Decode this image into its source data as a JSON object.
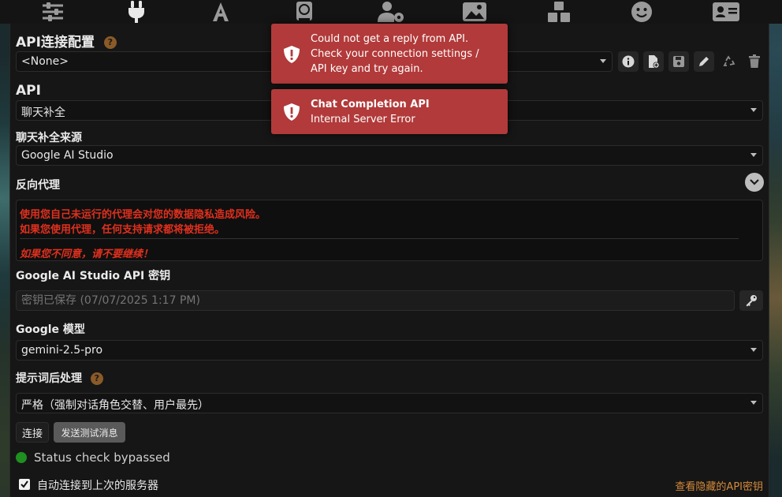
{
  "colors": {
    "panel_bg": "#161616",
    "toast_bg": "#b23a3a",
    "warning_text": "#e0301e",
    "help_badge": "#8a5a28",
    "status_dot": "#1f8f1f",
    "link": "#d58a3a"
  },
  "nav_icons": [
    "sliders-icon",
    "plug-icon",
    "font-icon",
    "book-globe-icon",
    "user-gear-icon",
    "image-icon",
    "cubes-icon",
    "smile-icon",
    "id-card-icon"
  ],
  "connection_profile": {
    "heading": "API连接配置",
    "help": "?",
    "selected": "<None>"
  },
  "api": {
    "heading": "API",
    "selected": "聊天补全"
  },
  "chat_source": {
    "heading": "聊天补全来源",
    "selected": "Google AI Studio"
  },
  "reverse_proxy": {
    "heading": "反向代理",
    "warning_line1": "使用您自己未运行的代理会对您的数据隐私造成风险。",
    "warning_line2": "如果您使用代理，任何支持请求都将被拒绝。",
    "warning_line3": "如果您不同意，请不要继续！"
  },
  "api_key": {
    "heading": "Google AI Studio API 密钥",
    "placeholder": "密钥已保存 (07/07/2025 1:17 PM)"
  },
  "model": {
    "heading": "Google 模型",
    "selected": "gemini-2.5-pro"
  },
  "prompt_processing": {
    "heading": "提示词后处理",
    "help": "?",
    "selected": "严格（强制对话角色交替、用户最先）"
  },
  "buttons": {
    "connect": "连接",
    "send_test": "发送测试消息"
  },
  "status": {
    "text": "Status check bypassed"
  },
  "auto_connect": {
    "label": "自动连接到上次的服务器",
    "checked": true
  },
  "hidden_keys_link": "查看隐藏的API密钥",
  "toasts": [
    {
      "lines": [
        "Could not get a reply from API.",
        "Check your connection settings /",
        "API key and try again."
      ]
    },
    {
      "title": "Chat Completion API",
      "body": "Internal Server Error"
    }
  ]
}
